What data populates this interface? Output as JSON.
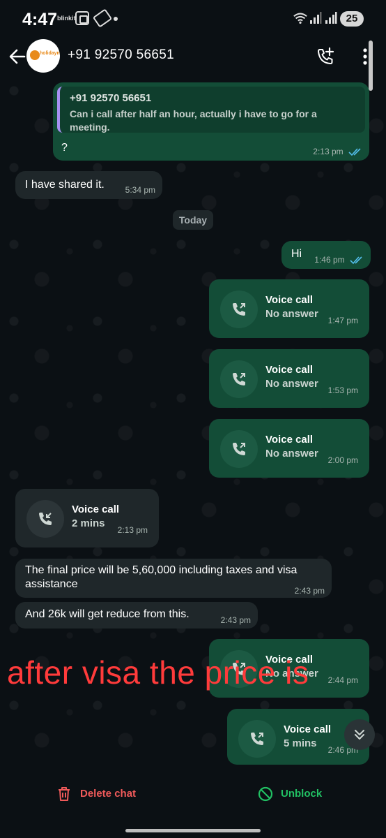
{
  "status_bar": {
    "time": "4:47",
    "app_label": "blinkit",
    "battery": "25"
  },
  "header": {
    "contact": "+91 92570 56651",
    "avatar_logo_text": "holidaymaker"
  },
  "messages": {
    "m1": {
      "quote_name": "+91 92570 56651",
      "quote_text": "Can i call after half an hour, actually i have to go for a meeting.",
      "text": "?",
      "time": "2:13 pm"
    },
    "m2": {
      "text": "I have shared it.",
      "time": "5:34 pm"
    },
    "date_divider": "Today",
    "m3": {
      "text": "Hi",
      "time": "1:46 pm"
    },
    "call1": {
      "title": "Voice call",
      "status": "No answer",
      "time": "1:47 pm"
    },
    "call2": {
      "title": "Voice call",
      "status": "No answer",
      "time": "1:53 pm"
    },
    "call3": {
      "title": "Voice call",
      "status": "No answer",
      "time": "2:00 pm"
    },
    "call4": {
      "title": "Voice call",
      "status": "2 mins",
      "time": "2:13 pm"
    },
    "m4": {
      "text": "The final price will be 5,60,000 including taxes and visa assistance",
      "time": "2:43 pm"
    },
    "m5": {
      "text": "And 26k will get reduce from this.",
      "time": "2:43 pm"
    },
    "call5": {
      "title": "Voice call",
      "status": "No answer",
      "time": "2:44 pm"
    },
    "call6": {
      "title": "Voice call",
      "status": "5 mins",
      "time": "2:46 pm"
    }
  },
  "overlay_annotation": "after visa the price is",
  "actions": {
    "delete": "Delete chat",
    "unblock": "Unblock"
  },
  "colors": {
    "outgoing_bubble": "#134d37",
    "incoming_bubble": "#1f272a",
    "delete_red": "#f05a5a",
    "unblock_green": "#21c063",
    "read_ticks": "#53bdeb",
    "annotation_red": "#ff3b3b"
  },
  "icons": [
    "back-arrow-icon",
    "add-call-icon",
    "more-vert-icon",
    "outgoing-call-icon",
    "incoming-call-icon",
    "double-check-icon",
    "chevron-double-down-icon",
    "trash-icon",
    "unblock-icon"
  ]
}
